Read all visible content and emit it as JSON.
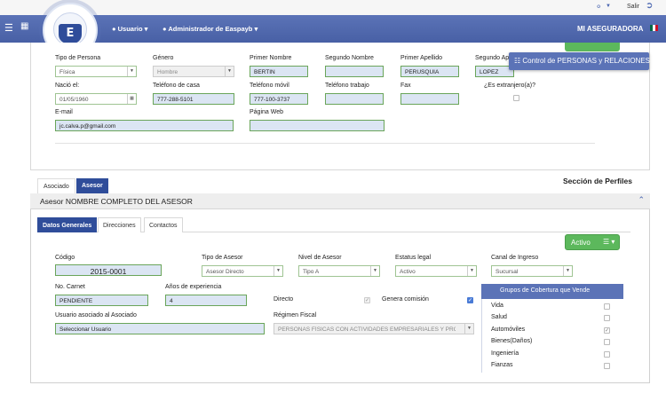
{
  "topbar": {
    "key_icon": "key-icon",
    "salir": "Salir",
    "exit_icon": "exit-icon"
  },
  "navbar": {
    "usuario": "Usuario",
    "admin": "Administrador de Easpayb",
    "aseguradora": "MI ASEGURADORA",
    "logo_letter": "E",
    "flag_colors": [
      "#006847",
      "#ffffff",
      "#ce1126"
    ]
  },
  "persona": {
    "tipo_persona": {
      "label": "Tipo de Persona",
      "value": "Física"
    },
    "genero": {
      "label": "Género",
      "value": "Hombre"
    },
    "primer_nombre": {
      "label": "Primer Nombre",
      "value": "BERTIN"
    },
    "segundo_nombre": {
      "label": "Segundo Nombre",
      "value": ""
    },
    "primer_apellido": {
      "label": "Primer Apellido",
      "value": "PERUSQUIA"
    },
    "segundo_apellido": {
      "label": "Segundo Ape",
      "value": "LOPEZ"
    },
    "nacio": {
      "label": "Nació el:",
      "value": "01/05/1960"
    },
    "tel_casa": {
      "label": "Teléfono de casa",
      "value": "777-288-5101"
    },
    "tel_movil": {
      "label": "Teléfono móvil",
      "value": "777-100-3737"
    },
    "tel_trabajo": {
      "label": "Teléfono trabajo",
      "value": ""
    },
    "fax": {
      "label": "Fax",
      "value": ""
    },
    "extranjero": {
      "label": "¿Es extranjero(a)?",
      "checked": false
    },
    "email": {
      "label": "E-mail",
      "value": "jc.calva.p@gmail.com"
    },
    "pagina_web": {
      "label": "Página Web",
      "value": ""
    }
  },
  "tooltip": "Control de PERSONAS y RELACIONES",
  "tabs": {
    "asociado": "Asociado",
    "asesor": "Asesor"
  },
  "perfiles_title": "Sección de Perfiles",
  "asesor_header": "Asesor NOMBRE COMPLETO DEL ASESOR",
  "subtabs": {
    "datos": "Datos Generales",
    "direcciones": "Direcciones",
    "contactos": "Contactos"
  },
  "estado_button": "Activo",
  "asesor": {
    "codigo": {
      "label": "Código",
      "value": "2015-0001"
    },
    "tipo_asesor": {
      "label": "Tipo de Asesor",
      "value": "Asesor Directo"
    },
    "nivel_asesor": {
      "label": "Nivel de Asesor",
      "value": "Tipo A"
    },
    "estatus_legal": {
      "label": "Estatus legal",
      "value": "Activo"
    },
    "canal_ingreso": {
      "label": "Canal de Ingreso",
      "value": "Sucursal"
    },
    "no_carnet": {
      "label": "No. Carnet",
      "value": "PENDIENTE"
    },
    "anios_exp": {
      "label": "Años de experiencia",
      "value": "4"
    },
    "directo": {
      "label": "Directo",
      "checked": true
    },
    "genera_comision": {
      "label": "Genera comisión",
      "checked": true
    },
    "usuario_asociado": {
      "label": "Usuario asociado al Asociado",
      "value": "Seleccionar Usuario"
    },
    "regimen_fiscal": {
      "label": "Régimen Fiscal",
      "value": "PERSONAS FÍSICAS CON ACTIVIDADES EMPRESARIALES Y PROFESIONALES"
    }
  },
  "grupos": {
    "title": "Grupos de Cobertura que Vende",
    "items": [
      {
        "label": "Vida",
        "checked": false
      },
      {
        "label": "Salud",
        "checked": false
      },
      {
        "label": "Automóviles",
        "checked": true
      },
      {
        "label": "Bienes(Daños)",
        "checked": false
      },
      {
        "label": "Ingeniería",
        "checked": false
      },
      {
        "label": "Fianzas",
        "checked": false
      }
    ]
  }
}
